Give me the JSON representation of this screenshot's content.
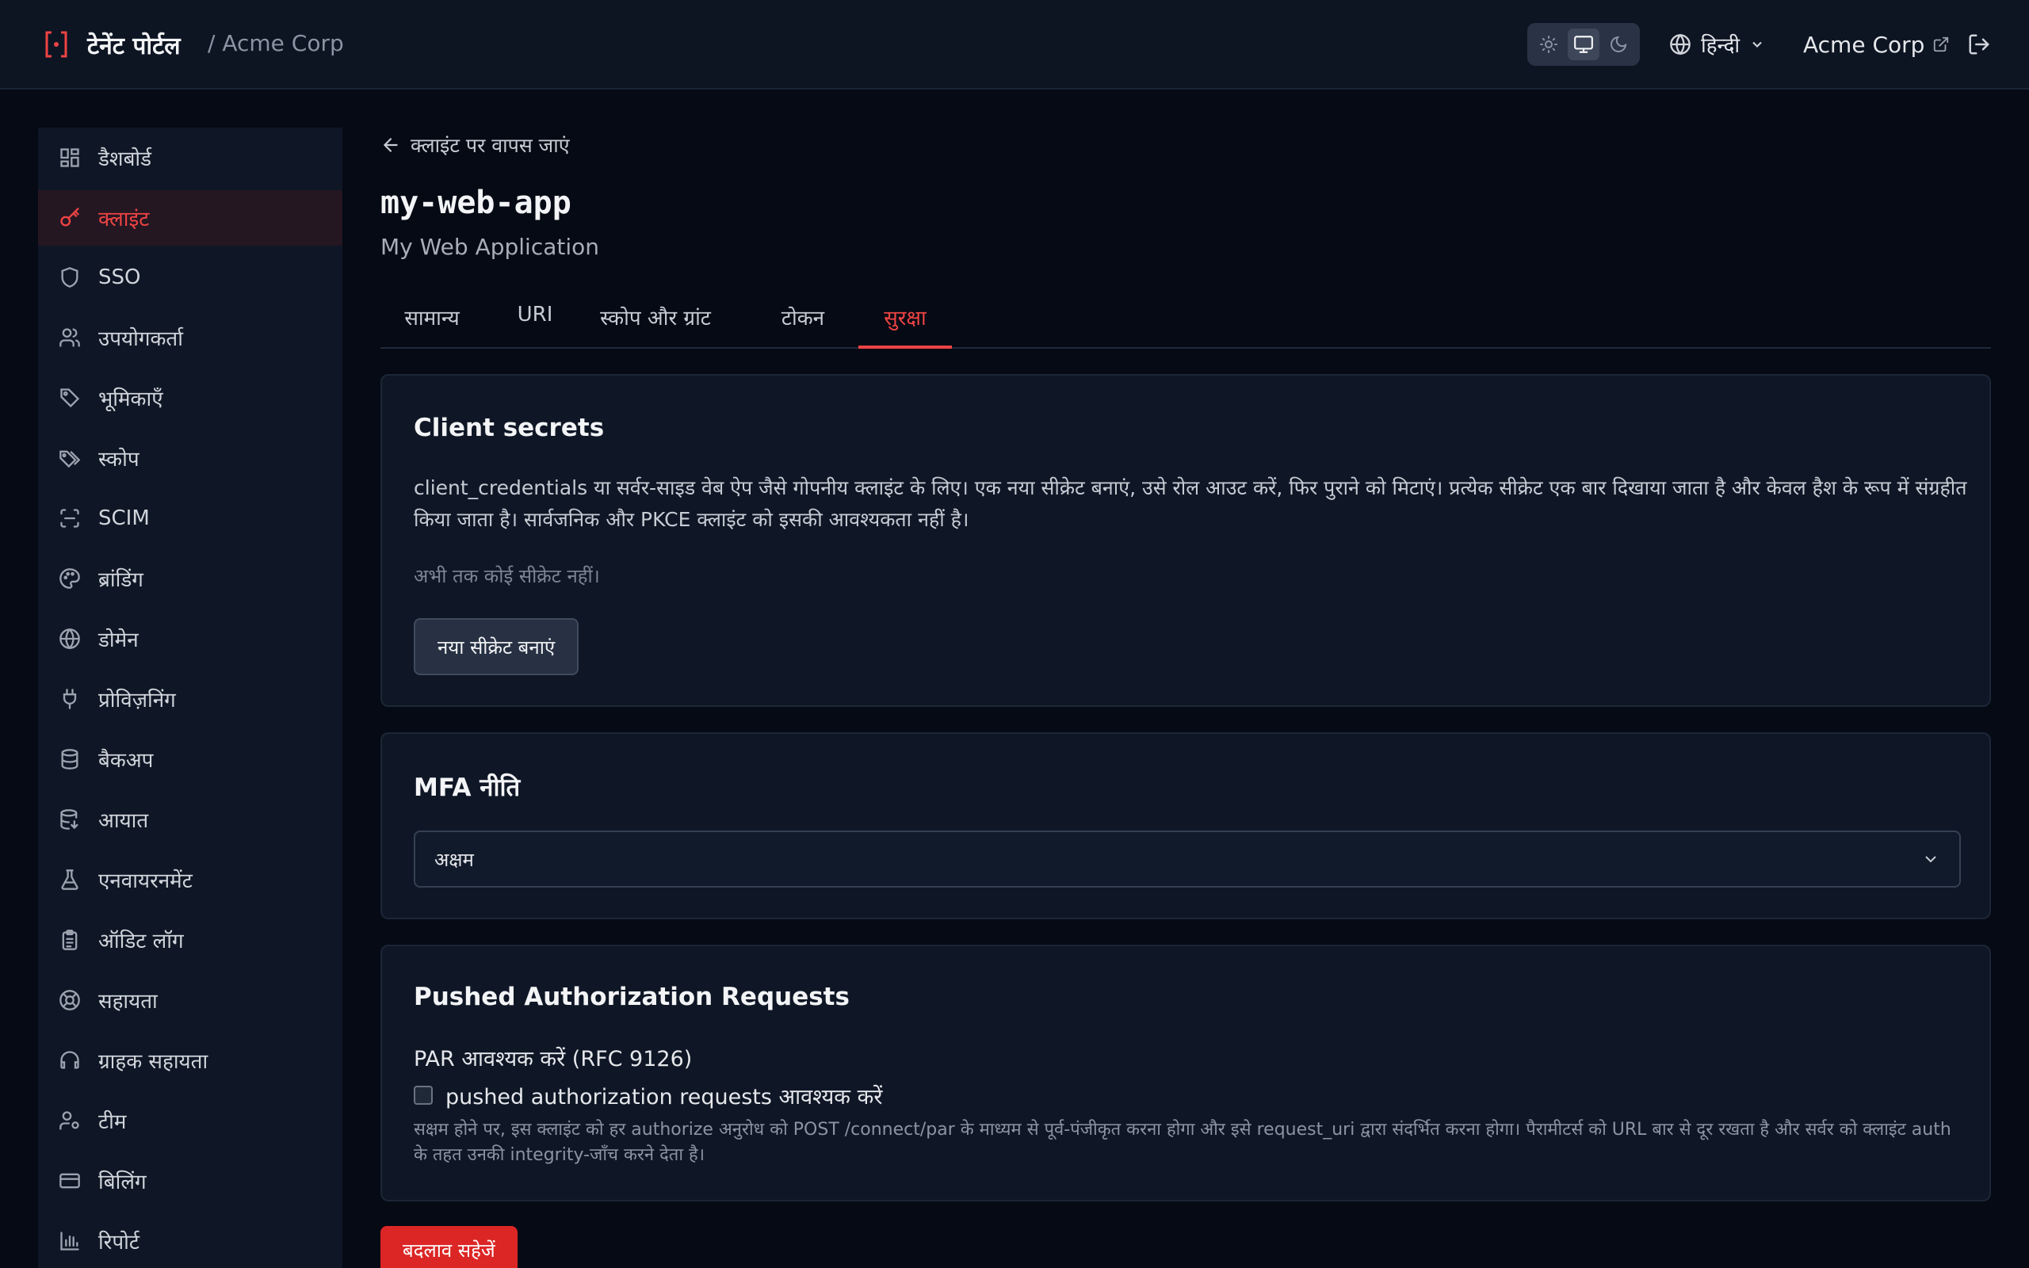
{
  "header": {
    "brand_title": "टेनेंट पोर्टल",
    "org_breadcrumb": "/ Acme Corp",
    "language": "हिन्दी",
    "org_name": "Acme Corp"
  },
  "sidebar": {
    "items": [
      {
        "label": "डैशबोर्ड",
        "icon": "dashboard-icon"
      },
      {
        "label": "क्लाइंट",
        "icon": "key-icon",
        "active": true
      },
      {
        "label": "SSO",
        "icon": "shield-icon"
      },
      {
        "label": "उपयोगकर्ता",
        "icon": "users-icon"
      },
      {
        "label": "भूमिकाएँ",
        "icon": "tag-icon"
      },
      {
        "label": "स्कोप",
        "icon": "tags-icon"
      },
      {
        "label": "SCIM",
        "icon": "scan-icon"
      },
      {
        "label": "ब्रांडिंग",
        "icon": "palette-icon"
      },
      {
        "label": "डोमेन",
        "icon": "globe-icon"
      },
      {
        "label": "प्रोविज़निंग",
        "icon": "plug-icon"
      },
      {
        "label": "बैकअप",
        "icon": "database-icon"
      },
      {
        "label": "आयात",
        "icon": "database-import-icon"
      },
      {
        "label": "एनवायरनमेंट",
        "icon": "flask-icon"
      },
      {
        "label": "ऑडिट लॉग",
        "icon": "clipboard-icon"
      },
      {
        "label": "सहायता",
        "icon": "lifebuoy-icon"
      },
      {
        "label": "ग्राहक सहायता",
        "icon": "headset-icon"
      },
      {
        "label": "टीम",
        "icon": "user-cog-icon"
      },
      {
        "label": "बिलिंग",
        "icon": "credit-card-icon"
      },
      {
        "label": "रिपोर्ट",
        "icon": "bar-chart-icon"
      }
    ]
  },
  "main": {
    "back_label": "क्लाइंट पर वापस जाएं",
    "client_id": "my-web-app",
    "client_name": "My Web Application",
    "tabs": [
      {
        "label": "सामान्य"
      },
      {
        "label": "URI"
      },
      {
        "label": "स्कोप और ग्रांट"
      },
      {
        "label": "टोकन"
      },
      {
        "label": "सुरक्षा",
        "active": true
      }
    ],
    "secrets": {
      "title": "Client secrets",
      "description": "client_credentials या सर्वर-साइड वेब ऐप जैसे गोपनीय क्लाइंट के लिए। एक नया सीक्रेट बनाएं, उसे रोल आउट करें, फिर पुराने को मिटाएं। प्रत्येक सीक्रेट एक बार दिखाया जाता है और केवल हैश के रूप में संग्रहीत किया जाता है। सार्वजनिक और PKCE क्लाइंट को इसकी आवश्यकता नहीं है।",
      "empty": "अभी तक कोई सीक्रेट नहीं।",
      "create_button": "नया सीक्रेट बनाएं"
    },
    "mfa": {
      "title": "MFA नीति",
      "selected": "अक्षम"
    },
    "par": {
      "title": "Pushed Authorization Requests",
      "label": "PAR आवश्यक करें (RFC 9126)",
      "checkbox_label": "pushed authorization requests आवश्यक करें",
      "checked": false,
      "help": "सक्षम होने पर, इस क्लाइंट को हर authorize अनुरोध को POST /connect/par के माध्यम से पूर्व-पंजीकृत करना होगा और इसे request_uri द्वारा संदर्भित करना होगा। पैरामीटर्स को URL बार से दूर रखता है और सर्वर को क्लाइंट auth के तहत उनकी integrity-जाँच करने देता है।"
    },
    "save_button": "बदलाव सहेजें"
  },
  "colors": {
    "accent": "#ef4444",
    "background": "#050a14",
    "panel": "#0f1726"
  }
}
